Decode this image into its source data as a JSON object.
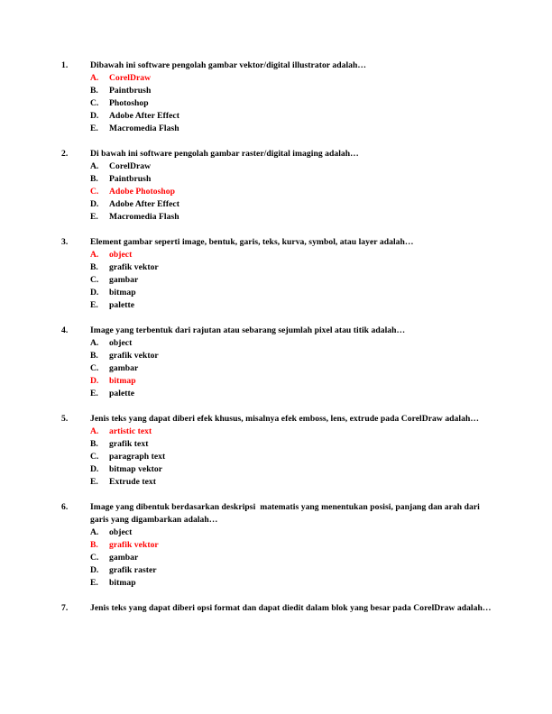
{
  "document": {
    "page_background": "#ffffff",
    "text_color": "#000000",
    "highlight_color": "#ff0000",
    "questions": [
      {
        "number": "1.",
        "stem": "Dibawah ini software pengolah gambar vektor/digital illustrator adalah…",
        "options": [
          {
            "letter": "A.",
            "text": "CorelDraw",
            "correct": true
          },
          {
            "letter": "B.",
            "text": "Paintbrush",
            "correct": false
          },
          {
            "letter": "C.",
            "text": "Photoshop",
            "correct": false
          },
          {
            "letter": "D.",
            "text": "Adobe After Effect",
            "correct": false
          },
          {
            "letter": "E.",
            "text": "Macromedia Flash",
            "correct": false
          }
        ]
      },
      {
        "number": "2.",
        "stem": "Di bawah ini software pengolah gambar raster/digital imaging adalah…",
        "options": [
          {
            "letter": "A.",
            "text": "CorelDraw",
            "correct": false
          },
          {
            "letter": "B.",
            "text": "Paintbrush",
            "correct": false
          },
          {
            "letter": "C.",
            "text": "Adobe Photoshop",
            "correct": true
          },
          {
            "letter": "D.",
            "text": "Adobe After Effect",
            "correct": false
          },
          {
            "letter": "E.",
            "text": "Macromedia Flash",
            "correct": false
          }
        ]
      },
      {
        "number": "3.",
        "stem": "Element gambar seperti image, bentuk, garis, teks, kurva, symbol, atau layer adalah…",
        "options": [
          {
            "letter": "A.",
            "text": "object",
            "correct": true
          },
          {
            "letter": "B.",
            "text": "grafik vektor",
            "correct": false
          },
          {
            "letter": "C.",
            "text": "gambar",
            "correct": false
          },
          {
            "letter": "D.",
            "text": "bitmap",
            "correct": false
          },
          {
            "letter": "E.",
            "text": "palette",
            "correct": false
          }
        ]
      },
      {
        "number": "4.",
        "stem": "Image yang terbentuk dari rajutan atau sebarang sejumlah pixel atau titik adalah…",
        "options": [
          {
            "letter": "A.",
            "text": "object",
            "correct": false
          },
          {
            "letter": "B.",
            "text": "grafik vektor",
            "correct": false
          },
          {
            "letter": "C.",
            "text": "gambar",
            "correct": false
          },
          {
            "letter": "D.",
            "text": "bitmap",
            "correct": true
          },
          {
            "letter": "E.",
            "text": "palette",
            "correct": false
          }
        ]
      },
      {
        "number": "5.",
        "stem": "Jenis teks yang dapat diberi efek khusus, misalnya efek emboss, lens, extrude pada CorelDraw adalah…",
        "options": [
          {
            "letter": "A.",
            "text": "artistic text",
            "correct": true
          },
          {
            "letter": "B.",
            "text": "grafik text",
            "correct": false
          },
          {
            "letter": "C.",
            "text": "paragraph text",
            "correct": false
          },
          {
            "letter": "D.",
            "text": "bitmap vektor",
            "correct": false
          },
          {
            "letter": "E.",
            "text": "Extrude text",
            "correct": false
          }
        ]
      },
      {
        "number": "6.",
        "stem": "Image yang dibentuk berdasarkan deskripsi  matematis yang menentukan posisi, panjang dan arah dari garis yang digambarkan adalah…",
        "options": [
          {
            "letter": "A.",
            "text": "object",
            "correct": false
          },
          {
            "letter": "B.",
            "text": "grafik vektor",
            "correct": true
          },
          {
            "letter": "C.",
            "text": "gambar",
            "correct": false
          },
          {
            "letter": "D.",
            "text": "grafik raster",
            "correct": false
          },
          {
            "letter": "E.",
            "text": "bitmap",
            "correct": false
          }
        ]
      },
      {
        "number": "7.",
        "stem": "Jenis teks yang dapat diberi opsi format dan dapat diedit dalam blok yang besar pada CorelDraw adalah…",
        "options": []
      }
    ]
  }
}
